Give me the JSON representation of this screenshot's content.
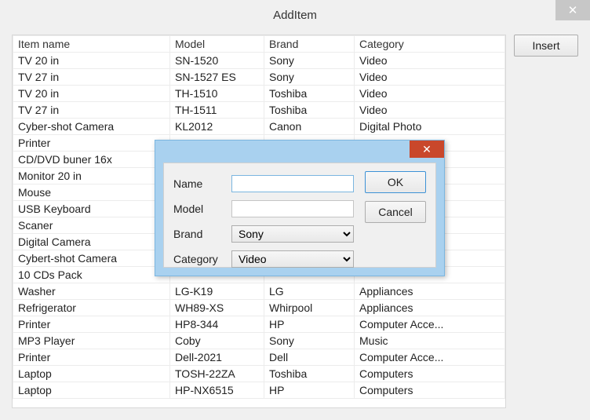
{
  "window": {
    "title": "AddItem",
    "close_glyph": "✕",
    "insert_label": "Insert"
  },
  "columns": [
    "Item name",
    "Model",
    "Brand",
    "Category"
  ],
  "rows": [
    {
      "name": "TV 20 in",
      "model": "SN-1520",
      "brand": "Sony",
      "category": "Video"
    },
    {
      "name": "TV 27 in",
      "model": "SN-1527 ES",
      "brand": "Sony",
      "category": "Video"
    },
    {
      "name": "TV 20 in",
      "model": "TH-1510",
      "brand": "Toshiba",
      "category": "Video"
    },
    {
      "name": "TV 27 in",
      "model": "TH-1511",
      "brand": "Toshiba",
      "category": "Video"
    },
    {
      "name": "Cyber-shot Camera",
      "model": "KL2012",
      "brand": "Canon",
      "category": "Digital Photo"
    },
    {
      "name": "Printer",
      "model": "",
      "brand": "",
      "category": ""
    },
    {
      "name": "CD/DVD buner 16x",
      "model": "",
      "brand": "",
      "category": ""
    },
    {
      "name": "Monitor 20 in",
      "model": "",
      "brand": "",
      "category": ""
    },
    {
      "name": "Mouse",
      "model": "",
      "brand": "",
      "category": ""
    },
    {
      "name": "USB Keyboard",
      "model": "",
      "brand": "",
      "category": ""
    },
    {
      "name": "Scaner",
      "model": "",
      "brand": "",
      "category": ""
    },
    {
      "name": "Digital Camera",
      "model": "",
      "brand": "",
      "category": ""
    },
    {
      "name": "Cybert-shot Camera",
      "model": "",
      "brand": "",
      "category": ""
    },
    {
      "name": "10 CDs Pack",
      "model": "",
      "brand": "",
      "category": ""
    },
    {
      "name": "Washer",
      "model": "LG-K19",
      "brand": "LG",
      "category": "Appliances"
    },
    {
      "name": "Refrigerator",
      "model": "WH89-XS",
      "brand": "Whirpool",
      "category": "Appliances"
    },
    {
      "name": "Printer",
      "model": "HP8-344",
      "brand": "HP",
      "category": "Computer Acce..."
    },
    {
      "name": "MP3 Player",
      "model": "Coby",
      "brand": "Sony",
      "category": "Music"
    },
    {
      "name": "Printer",
      "model": "Dell-2021",
      "brand": "Dell",
      "category": "Computer Acce..."
    },
    {
      "name": "Laptop",
      "model": "TOSH-22ZA",
      "brand": "Toshiba",
      "category": "Computers"
    },
    {
      "name": "Laptop",
      "model": "HP-NX6515",
      "brand": "HP",
      "category": "Computers"
    }
  ],
  "dialog": {
    "close_glyph": "✕",
    "labels": {
      "name": "Name",
      "model": "Model",
      "brand": "Brand",
      "category": "Category"
    },
    "fields": {
      "name": "",
      "model": "",
      "brand_selected": "Sony",
      "category_selected": "Video"
    },
    "buttons": {
      "ok": "OK",
      "cancel": "Cancel"
    }
  }
}
